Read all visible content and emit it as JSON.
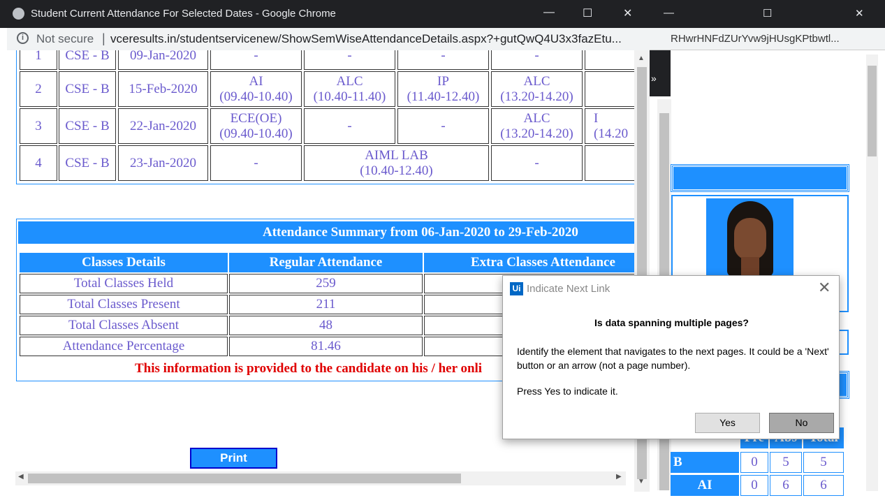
{
  "front_window": {
    "title": "Student Current Attendance For Selected Dates - Google Chrome",
    "security_label": "Not secure",
    "url": "vceresults.in/studentservicenew/ShowSemWiseAttendanceDetails.aspx?+gutQwQ4U3x3fazEtu..."
  },
  "back_window": {
    "url_fragment": "RHwrHNFdZUrYvw9jHUsgKPtbwtl...",
    "tab_overflow": "»",
    "mini_table": {
      "headers": [
        "Pre",
        "Abs",
        "Total"
      ],
      "rows": [
        {
          "label": "B",
          "values": [
            "0",
            "5",
            "5"
          ]
        },
        {
          "label": "AI",
          "values": [
            "0",
            "6",
            "6"
          ]
        }
      ]
    }
  },
  "timetable": {
    "rows": [
      {
        "sno": "1",
        "section": "CSE - B",
        "date": "09-Jan-2020",
        "slots": [
          "-",
          "-",
          "-",
          "-",
          ""
        ]
      },
      {
        "sno": "2",
        "section": "CSE - B",
        "date": "15-Feb-2020",
        "slots": [
          [
            "AI",
            "(09.40-10.40)"
          ],
          [
            "ALC",
            "(10.40-11.40)"
          ],
          [
            "IP",
            "(11.40-12.40)"
          ],
          [
            "ALC",
            "(13.20-14.20)"
          ],
          ""
        ]
      },
      {
        "sno": "3",
        "section": "CSE - B",
        "date": "22-Jan-2020",
        "slots": [
          [
            "ECE(OE)",
            "(09.40-10.40)"
          ],
          "-",
          "-",
          [
            "ALC",
            "(13.20-14.20)"
          ],
          [
            "I",
            "(14.20"
          ]
        ]
      },
      {
        "sno": "4",
        "section": "CSE - B",
        "date": "23-Jan-2020",
        "slots": [
          "-",
          [
            "AIML LAB",
            "(10.40-12.40)"
          ],
          "-",
          ""
        ]
      }
    ]
  },
  "summary": {
    "title": "Attendance Summary from 06-Jan-2020 to 29-Feb-2020",
    "columns": [
      "Classes Details",
      "Regular Attendance",
      "Extra Classes Attendance"
    ],
    "rows": [
      {
        "label": "Total Classes Held",
        "regular": "259",
        "extra": ""
      },
      {
        "label": "Total Classes Present",
        "regular": "211",
        "extra": ""
      },
      {
        "label": "Total Classes Absent",
        "regular": "48",
        "extra": ""
      },
      {
        "label": "Attendance Percentage",
        "regular": "81.46",
        "extra": ""
      }
    ],
    "notice": "This information is provided to the candidate on his / her onli"
  },
  "print_label": "Print",
  "dialog": {
    "logo": "Ui",
    "title": "Indicate Next Link",
    "question": "Is data spanning multiple pages?",
    "body": "Identify the element that navigates to the next pages. It could be a 'Next' button or an arrow (not a page number).",
    "press": "Press Yes to indicate it.",
    "yes_label": "Yes",
    "no_label": "No"
  },
  "colors": {
    "accent": "#1e90ff",
    "cell_text": "#6a5acd",
    "notice": "#e00000"
  }
}
